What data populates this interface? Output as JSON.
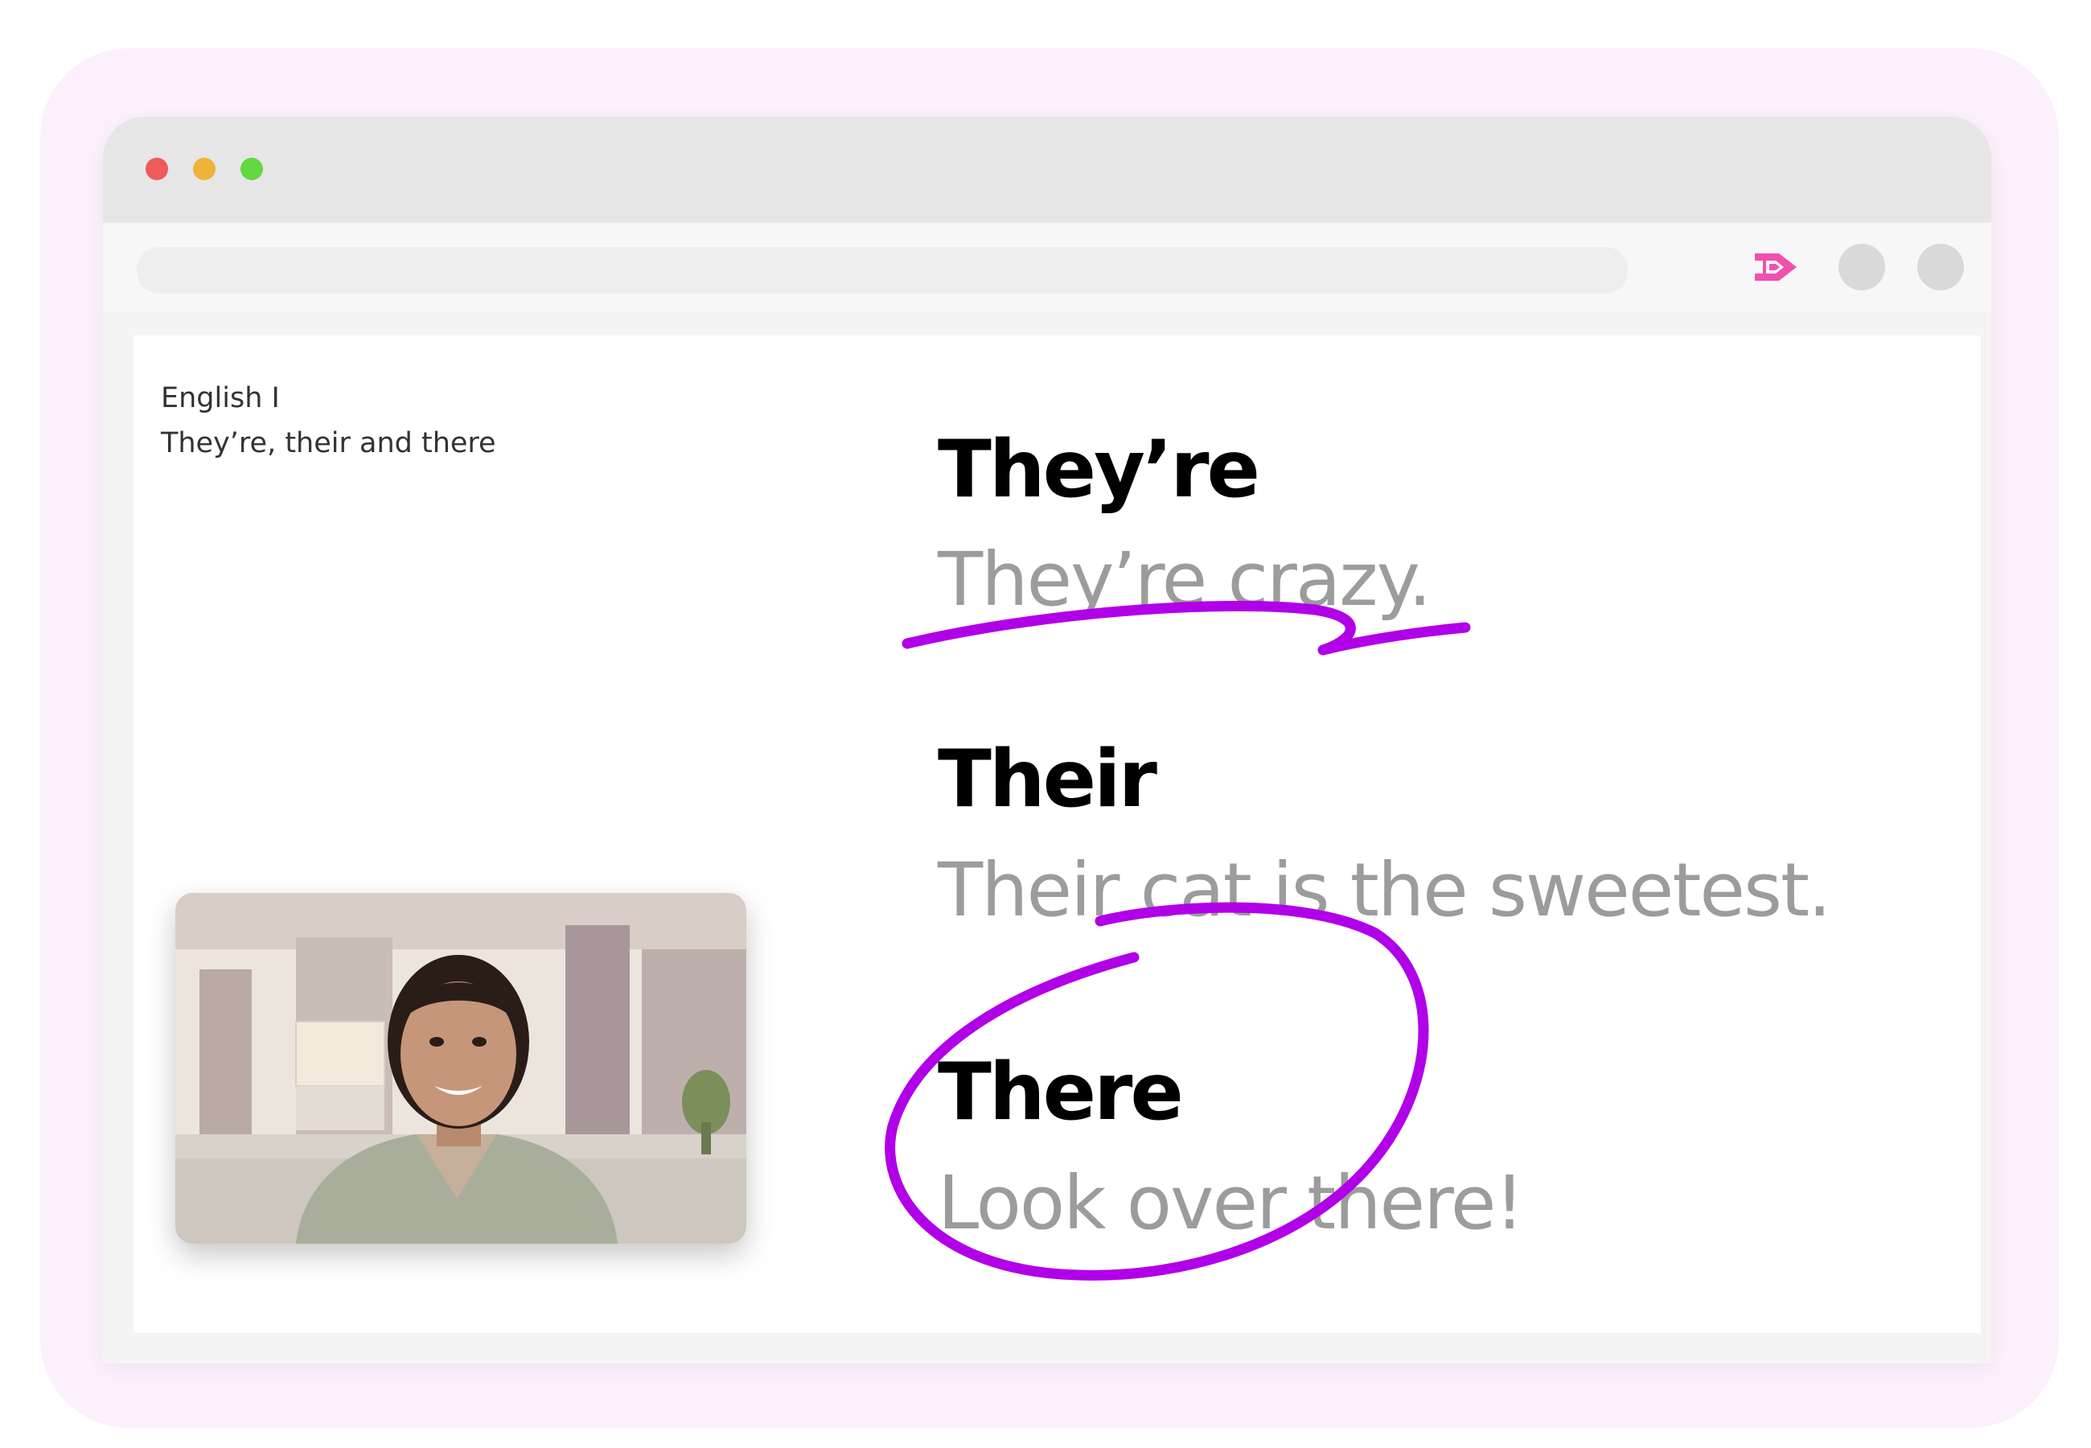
{
  "course": {
    "subject": "English I",
    "lesson": "They’re, their and there"
  },
  "terms": [
    {
      "word": "They’re",
      "example": "They’re crazy."
    },
    {
      "word": "Their",
      "example": "Their cat is the sweetest."
    },
    {
      "word": "There",
      "example": "Look over there!"
    }
  ],
  "colors": {
    "accent": "#b100e8",
    "brand_icon": "#f24fae",
    "term_text": "#000000",
    "example_text": "#9c9c9c",
    "backdrop": "#fcf0fd"
  },
  "window_controls": [
    "close",
    "minimize",
    "maximize"
  ],
  "toolbar": {
    "extension_icon": "play-arrow-icon",
    "buttons": [
      "profile-button",
      "menu-button"
    ]
  },
  "video_tile": {
    "icon": "webcam-participant-image"
  }
}
